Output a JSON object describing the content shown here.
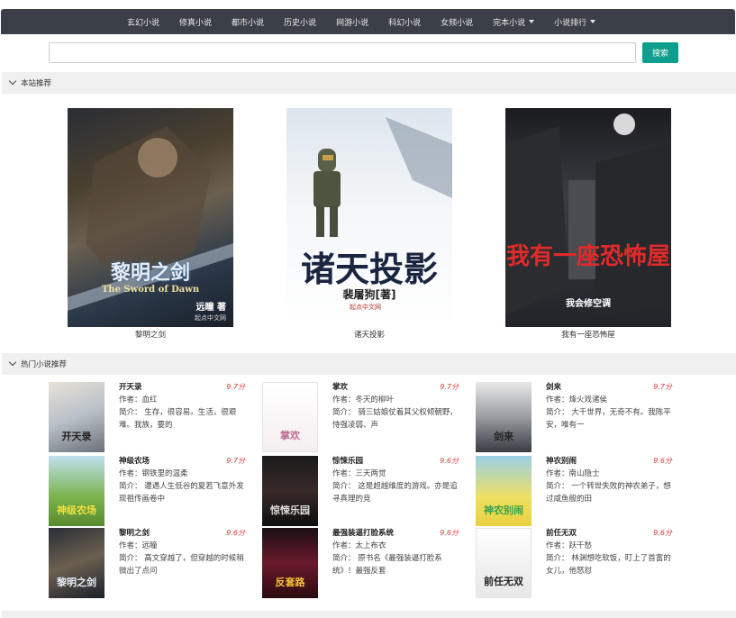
{
  "nav": {
    "items": [
      {
        "label": "玄幻小说",
        "dropdown": false
      },
      {
        "label": "修真小说",
        "dropdown": false
      },
      {
        "label": "都市小说",
        "dropdown": false
      },
      {
        "label": "历史小说",
        "dropdown": false
      },
      {
        "label": "网游小说",
        "dropdown": false
      },
      {
        "label": "科幻小说",
        "dropdown": false
      },
      {
        "label": "女频小说",
        "dropdown": false
      },
      {
        "label": "完本小说",
        "dropdown": true
      },
      {
        "label": "小说排行",
        "dropdown": true
      }
    ]
  },
  "search": {
    "value": "",
    "button_label": "搜索"
  },
  "sections": {
    "recommend_label": "本站推荐",
    "hot_label": "热门小说推荐"
  },
  "featured": [
    {
      "title": "黎明之剑",
      "cover_title": "黎明之剑",
      "cover_subtitle": "The Sword of Dawn",
      "cover_author": "远瞳 著",
      "cover_publisher": "起点中文网"
    },
    {
      "title": "诸天投影",
      "cover_title": "诸天投影",
      "cover_author": "裴屠狗[著]",
      "cover_publisher": "起点中文网"
    },
    {
      "title": "我有一座恐怖屋",
      "cover_title": "我有一座恐怖屋",
      "cover_author": "我会修空调"
    }
  ],
  "hot": [
    {
      "name": "开天录",
      "score": "9.7分",
      "author": "作者：血红",
      "desc": "简介：      生存，很容易。生活，很艰难。我族，要的",
      "cover_text": "开天录"
    },
    {
      "name": "掌欢",
      "score": "9.7分",
      "author": "作者：冬天的柳叶",
      "desc": "简介：      骑三姑娘仗着其父权倾朝野，恃强凌弱、声",
      "cover_text": "掌欢"
    },
    {
      "name": "剑来",
      "score": "9.7分",
      "author": "作者：烽火戏诸侯",
      "desc": "简介：      大千世界，无奇不有。我陈平安，唯有一",
      "cover_text": "剑来"
    },
    {
      "name": "神级农场",
      "score": "9.7分",
      "author": "作者：钢铁里的温柔",
      "desc": "简介：      遭遇人生低谷的夏若飞意外发现祖传画卷中",
      "cover_text": "神级农场"
    },
    {
      "name": "惊悚乐园",
      "score": "9.6分",
      "author": "作者：三天两觉",
      "desc": "简介：      这是超越维度的游戏。亦是追寻真理的竞",
      "cover_text": "惊悚乐园"
    },
    {
      "name": "神农别闹",
      "score": "9.6分",
      "author": "作者：南山隐士",
      "desc": "简介：      一个转世失败的神农弟子，想过咸鱼般的田",
      "cover_text": "神农别闹"
    },
    {
      "name": "黎明之剑",
      "score": "9.6分",
      "author": "作者：远瞳",
      "desc": "简介：      高文穿越了，但穿越的时候稍微出了点问",
      "cover_text": "黎明之剑"
    },
    {
      "name": "最强装逼打脸系统",
      "score": "9.6分",
      "author": "作者：太上布衣",
      "desc": "简介：      原书名《最强装逼打脸系统》！最强反套",
      "cover_text": "反套路"
    },
    {
      "name": "前任无双",
      "score": "9.6分",
      "author": "作者：跃千愁",
      "desc": "简介：      林渊想吃软饭，盯上了首富的女儿，他怒怼",
      "cover_text": "前任无双"
    }
  ],
  "colors": {
    "nav_bg": "#3b3f47",
    "search_button": "#0e9e8d",
    "score": "#e53a3a",
    "section_bg": "#f0f0f0"
  }
}
